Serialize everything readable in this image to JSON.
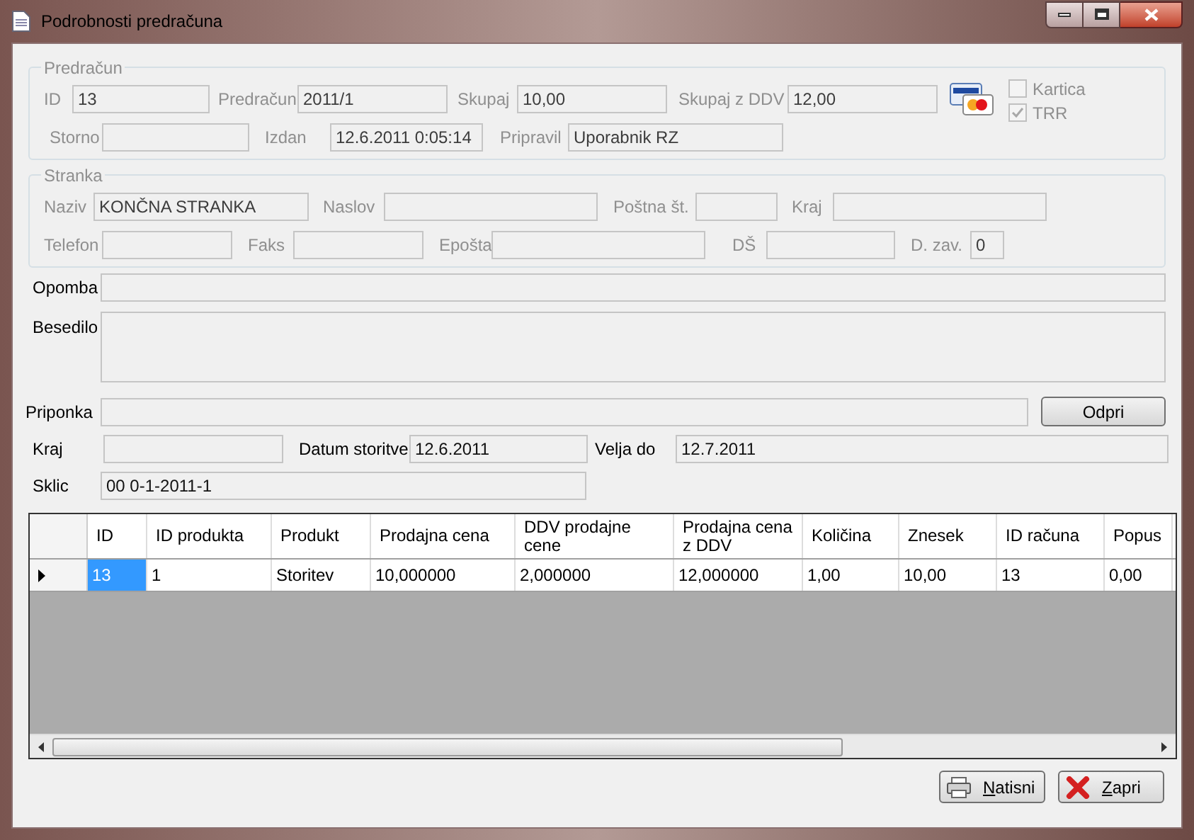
{
  "window": {
    "title": "Podrobnosti predračuna"
  },
  "invoice_group": {
    "title": "Predračun",
    "disabled": true,
    "rows": [
      [
        {
          "label": "ID",
          "value": "13"
        },
        {
          "label": "Predračun",
          "value": "2011/1"
        },
        {
          "label": "Skupaj",
          "value": "10,00"
        },
        {
          "label": "Skupaj z DDV",
          "value": "12,00"
        }
      ],
      [
        {
          "label": "Storno"
        },
        {
          "label": "Izdan",
          "value": "12.6.2011 0:05:14"
        },
        {
          "label": "Pripravil",
          "value": "Uporabnik RZ"
        }
      ]
    ],
    "checkboxes": [
      {
        "label": "Kartica",
        "checked": false
      },
      {
        "label": "TRR",
        "checked": true
      }
    ]
  },
  "customer_group": {
    "title": "Stranka",
    "disabled": true,
    "rows": [
      [
        {
          "label": "Naziv",
          "value": "KONČNA STRANKA"
        },
        {
          "label": "Naslov"
        },
        {
          "label": "Poštna št."
        },
        {
          "label": "Kraj"
        }
      ],
      [
        {
          "label": "Telefon"
        },
        {
          "label": "Faks"
        },
        {
          "label": "Epošta"
        },
        {
          "label": "DŠ"
        },
        {
          "label": "D. zav.",
          "value": "0"
        }
      ]
    ]
  },
  "note": {
    "label": "Opomba"
  },
  "text": {
    "label": "Besedilo"
  },
  "attachment": {
    "label": "Priponka",
    "button": "Odpri"
  },
  "details": [
    {
      "label": "Kraj"
    },
    {
      "label": "Datum storitve",
      "value": "12.6.2011"
    },
    {
      "label": "Velja do",
      "value": "12.7.2011"
    }
  ],
  "reference": {
    "label": "Sklic",
    "value": "00 0-1-2011-1"
  },
  "table": {
    "columns": [
      "ID",
      "ID produkta",
      "Produkt",
      "Prodajna cena",
      "DDV prodajne cene",
      "Prodajna cena z DDV",
      "Količina",
      "Znesek",
      "ID računa",
      "Popus"
    ],
    "rows": [
      {
        "current": true,
        "cells": [
          {
            "text": "13",
            "selected": true
          },
          {
            "text": "1",
            "selected": false
          },
          {
            "text": "Storitev",
            "selected": false
          },
          {
            "text": "10,000000",
            "selected": false
          },
          {
            "text": "2,000000",
            "selected": false
          },
          {
            "text": "12,000000",
            "selected": false
          },
          {
            "text": "1,00",
            "selected": false
          },
          {
            "text": "10,00",
            "selected": false
          },
          {
            "text": "13",
            "selected": false
          },
          {
            "text": "0,00",
            "selected": false
          }
        ]
      }
    ]
  },
  "buttons": [
    {
      "kind": "print",
      "label": "Natisni",
      "access_key_underlined": true
    },
    {
      "kind": "close",
      "label": "Zapri",
      "access_key_underlined": true
    }
  ]
}
